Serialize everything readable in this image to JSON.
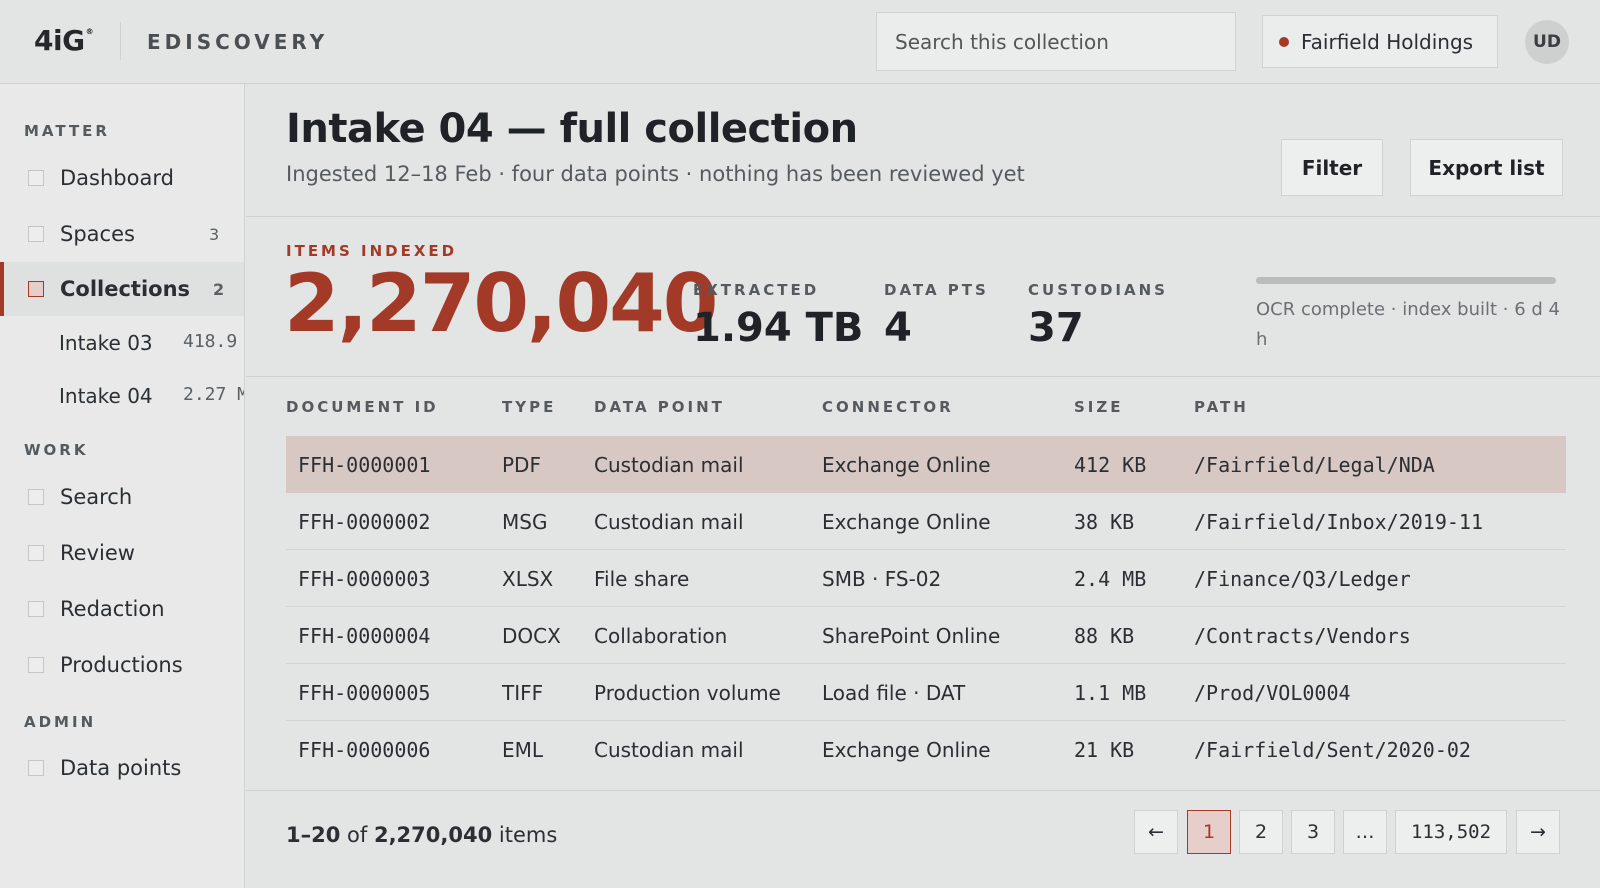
{
  "header": {
    "logo": "4iG",
    "logo_mark": "®",
    "app_name": "EDISCOVERY",
    "search_placeholder": "Search this collection",
    "org_name": "Fairfield Holdings",
    "avatar": "UD"
  },
  "sidebar": {
    "sections": {
      "matter": "MATTER",
      "work": "WORK",
      "admin": "ADMIN"
    },
    "matter_items": [
      {
        "label": "Dashboard",
        "count": ""
      },
      {
        "label": "Spaces",
        "count": "3"
      },
      {
        "label": "Collections",
        "count": "2",
        "active": true
      }
    ],
    "sub_items": [
      {
        "label": "Intake 03",
        "size": "418.9"
      },
      {
        "label": "Intake 04",
        "size": "2.27 M"
      }
    ],
    "work_items": [
      {
        "label": "Search"
      },
      {
        "label": "Review"
      },
      {
        "label": "Redaction"
      },
      {
        "label": "Productions"
      }
    ],
    "admin_items": [
      {
        "label": "Data points"
      }
    ]
  },
  "page": {
    "title": "Intake 04 — full collection",
    "subtitle": "Ingested 12–18 Feb · four data points · nothing has been reviewed yet",
    "filter_label": "Filter",
    "export_label": "Export list"
  },
  "stats": {
    "items_label": "ITEMS INDEXED",
    "items_value": "2,270,040",
    "extracted_label": "EXTRACTED",
    "extracted_value": "1.94 TB",
    "datapts_label": "DATA PTS",
    "datapts_value": "4",
    "custodians_label": "CUSTODIANS",
    "custodians_value": "37",
    "status": "OCR complete · index built · 6 d 4 h",
    "progress": 1.0
  },
  "table": {
    "columns": [
      "DOCUMENT ID",
      "TYPE",
      "DATA POINT",
      "CONNECTOR",
      "SIZE",
      "PATH"
    ],
    "rows": [
      {
        "id": "FFH-0000001",
        "type": "PDF",
        "data_point": "Custodian mail",
        "connector": "Exchange Online",
        "size": "412 KB",
        "path": "/Fairfield/Legal/NDA"
      },
      {
        "id": "FFH-0000002",
        "type": "MSG",
        "data_point": "Custodian mail",
        "connector": "Exchange Online",
        "size": "38 KB",
        "path": "/Fairfield/Inbox/2019-11"
      },
      {
        "id": "FFH-0000003",
        "type": "XLSX",
        "data_point": "File share",
        "connector": "SMB · FS-02",
        "size": "2.4 MB",
        "path": "/Finance/Q3/Ledger"
      },
      {
        "id": "FFH-0000004",
        "type": "DOCX",
        "data_point": "Collaboration",
        "connector": "SharePoint Online",
        "size": "88 KB",
        "path": "/Contracts/Vendors"
      },
      {
        "id": "FFH-0000005",
        "type": "TIFF",
        "data_point": "Production volume",
        "connector": "Load file · DAT",
        "size": "1.1 MB",
        "path": "/Prod/VOL0004"
      },
      {
        "id": "FFH-0000006",
        "type": "EML",
        "data_point": "Custodian mail",
        "connector": "Exchange Online",
        "size": "21 KB",
        "path": "/Fairfield/Sent/2020-02"
      }
    ]
  },
  "footer": {
    "range": "1–20",
    "of": "of",
    "total": "2,270,040",
    "items_word": "items",
    "pages": {
      "prev": "←",
      "p1": "1",
      "p2": "2",
      "p3": "3",
      "ellipsis": "…",
      "last": "113,502",
      "next": "→"
    }
  }
}
